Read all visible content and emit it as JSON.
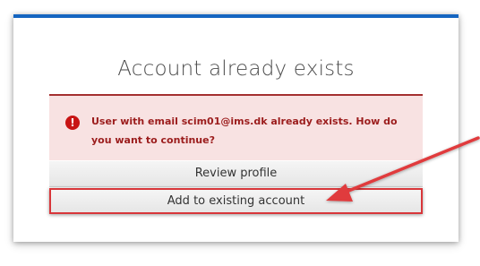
{
  "dialog": {
    "title": "Account already exists",
    "accent_color": "#1565c0"
  },
  "alert": {
    "icon": "exclamation-circle-icon",
    "message": "User with email scim01@ims.dk already exists. How do you want to continue?",
    "color": "#9b1c1c",
    "background": "#f8e2e2"
  },
  "actions": {
    "review_profile_label": "Review profile",
    "add_to_existing_label": "Add to existing account"
  },
  "annotation": {
    "arrow_color": "#e03a3c",
    "highlight_color": "#d8363a"
  }
}
